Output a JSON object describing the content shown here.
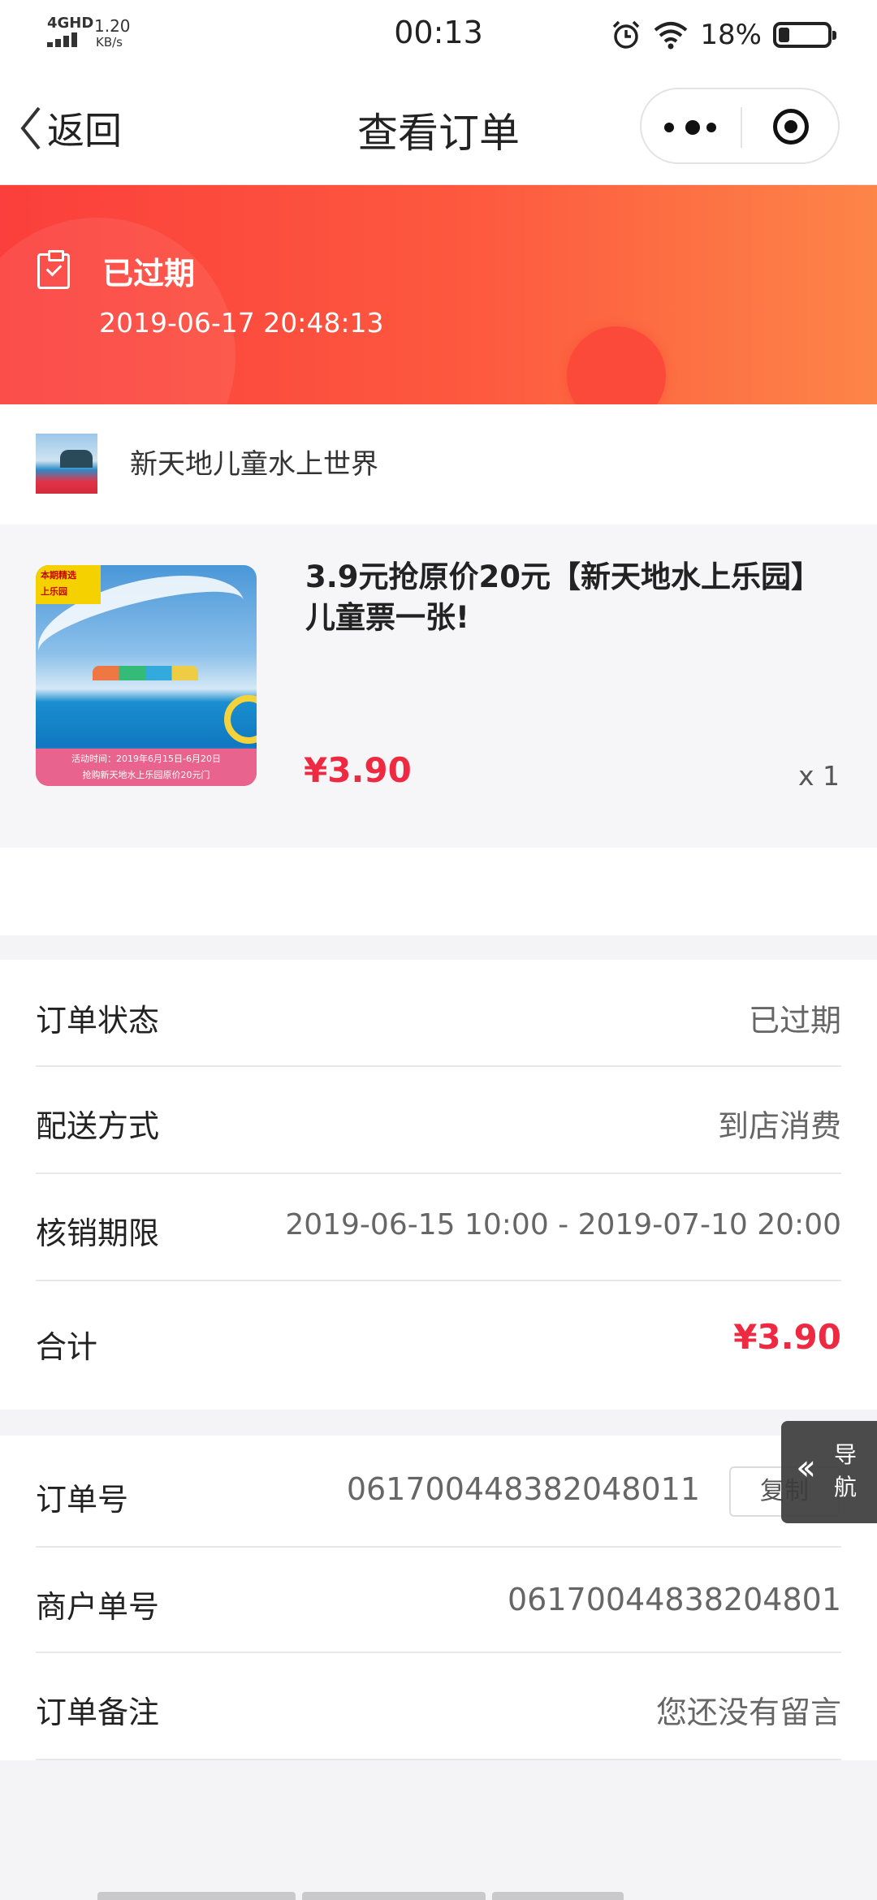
{
  "status_bar": {
    "network": "4GHD",
    "speed": "1.20",
    "speed_unit": "KB/s",
    "time": "00:13",
    "battery": "18%"
  },
  "nav": {
    "back_label": "返回",
    "title": "查看订单"
  },
  "order_status": {
    "label": "已过期",
    "timestamp": "2019-06-17 20:48:13"
  },
  "shop": {
    "name": "新天地儿童水上世界"
  },
  "product": {
    "title": "3.9元抢原价20元【新天地水上乐园】儿童票一张!",
    "price": "¥3.90",
    "quantity": "x 1",
    "image_text": {
      "tag_line1": "本期精选",
      "tag_line2": "上乐园",
      "activity": "活动时间：2019年6月15日-6月20日",
      "banner": "抢购新天地水上乐园原价20元门"
    }
  },
  "details": [
    {
      "label": "订单状态",
      "value": "已过期"
    },
    {
      "label": "配送方式",
      "value": "到店消费"
    },
    {
      "label": "核销期限",
      "value": "2019-06-15 10:00 - 2019-07-10 20:00"
    },
    {
      "label": "合计",
      "value": "¥3.90"
    }
  ],
  "order_info": [
    {
      "label": "订单号",
      "value": "061700448382048011"
    },
    {
      "label": "商户单号",
      "value": "06170044838204801"
    },
    {
      "label": "订单备注",
      "value": "您还没有留言"
    }
  ],
  "copy_label": "复制",
  "float_nav": {
    "label_top": "导",
    "label_bottom": "航"
  },
  "colors": {
    "accent_red": "#ee2a42",
    "banner_start": "#fb3f3c",
    "banner_end": "#fd8548"
  },
  "icons": [
    "signal-icon",
    "alarm-icon",
    "wifi-icon",
    "battery-icon",
    "back-chevron-icon",
    "more-dots-icon",
    "target-icon",
    "clipboard-check-icon",
    "double-chevron-left-icon"
  ]
}
